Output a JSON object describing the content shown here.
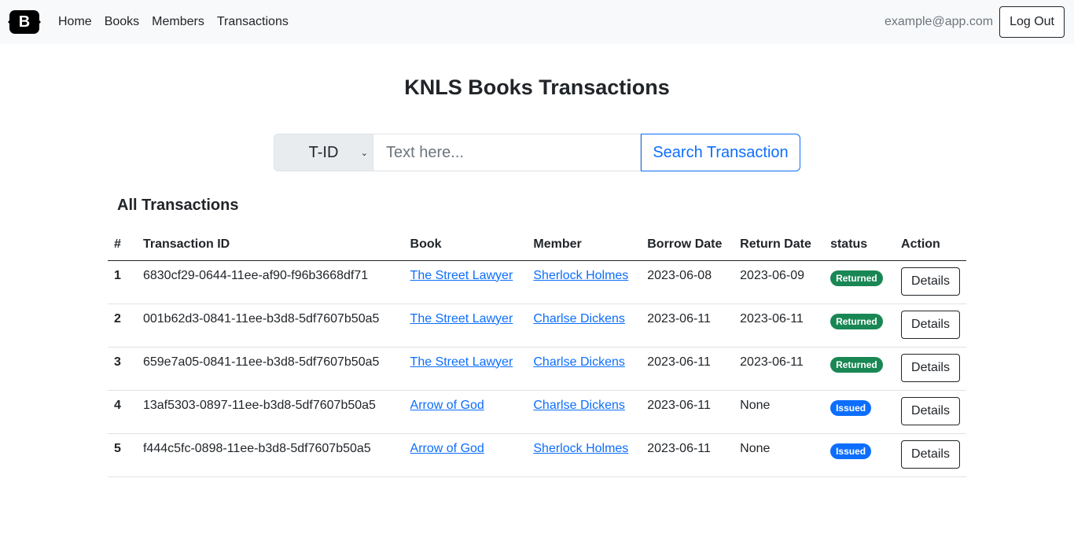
{
  "nav": {
    "logo": "B",
    "links": [
      "Home",
      "Books",
      "Members",
      "Transactions"
    ],
    "email": "example@app.com",
    "logout": "Log Out"
  },
  "title": "KNLS Books Transactions",
  "search": {
    "select": "T-ID",
    "placeholder": "Text here...",
    "button": "Search Transaction"
  },
  "section_title": "All Transactions",
  "table": {
    "headers": [
      "#",
      "Transaction ID",
      "Book",
      "Member",
      "Borrow Date",
      "Return Date",
      "status",
      "Action"
    ],
    "rows": [
      {
        "n": "1",
        "id": "6830cf29-0644-11ee-af90-f96b3668df71",
        "book": "The Street Lawyer",
        "member": "Sherlock Holmes",
        "borrow": "2023-06-08",
        "return": "2023-06-09",
        "status": "Returned",
        "action": "Details"
      },
      {
        "n": "2",
        "id": "001b62d3-0841-11ee-b3d8-5df7607b50a5",
        "book": "The Street Lawyer",
        "member": "Charlse Dickens",
        "borrow": "2023-06-11",
        "return": "2023-06-11",
        "status": "Returned",
        "action": "Details"
      },
      {
        "n": "3",
        "id": "659e7a05-0841-11ee-b3d8-5df7607b50a5",
        "book": "The Street Lawyer",
        "member": "Charlse Dickens",
        "borrow": "2023-06-11",
        "return": "2023-06-11",
        "status": "Returned",
        "action": "Details"
      },
      {
        "n": "4",
        "id": "13af5303-0897-11ee-b3d8-5df7607b50a5",
        "book": "Arrow of God",
        "member": "Charlse Dickens",
        "borrow": "2023-06-11",
        "return": "None",
        "status": "Issued",
        "action": "Details"
      },
      {
        "n": "5",
        "id": "f444c5fc-0898-11ee-b3d8-5df7607b50a5",
        "book": "Arrow of God",
        "member": "Sherlock Holmes",
        "borrow": "2023-06-11",
        "return": "None",
        "status": "Issued",
        "action": "Details"
      }
    ]
  },
  "colors": {
    "Returned": "#198754",
    "Issued": "#0d6efd"
  }
}
